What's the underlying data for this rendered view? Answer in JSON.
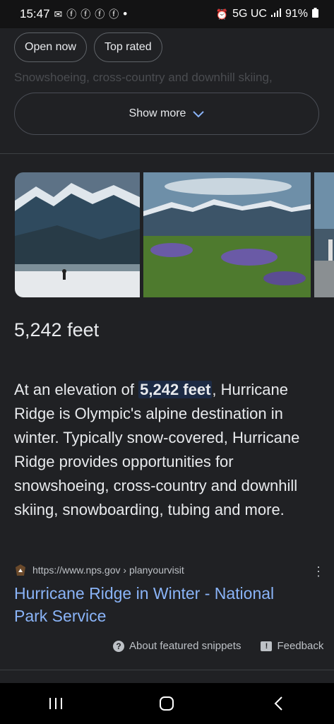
{
  "status_bar": {
    "time": "15:47",
    "notification_icons": [
      "message-icon",
      "facebook-icon",
      "facebook-icon",
      "facebook-icon",
      "facebook-icon"
    ],
    "dot": "•",
    "network": "5G UC",
    "battery": "91%"
  },
  "filters": {
    "chips": [
      "Open now",
      "Top rated"
    ]
  },
  "faded_text": "Snowshoeing, cross-country and downhill skiing,",
  "show_more": {
    "label": "Show more"
  },
  "featured_snippet": {
    "answer": "5,242 feet",
    "snippet_before": "At an elevation of ",
    "snippet_highlight": "5,242 feet",
    "snippet_after": ", Hurricane Ridge is Olympic's alpine destination in winter. Typically snow-covered, Hurricane Ridge provides opportunities for snowshoeing, cross-country and downhill skiing, snowboarding, tubing and more.",
    "source_url": "https://www.nps.gov › planyourvisit",
    "title": "Hurricane Ridge in Winter - National Park Service"
  },
  "footer": {
    "about": "About featured snippets",
    "feedback": "Feedback"
  },
  "colors": {
    "background": "#202124",
    "link": "#8ab4f8",
    "highlight": "#1c2a44"
  }
}
